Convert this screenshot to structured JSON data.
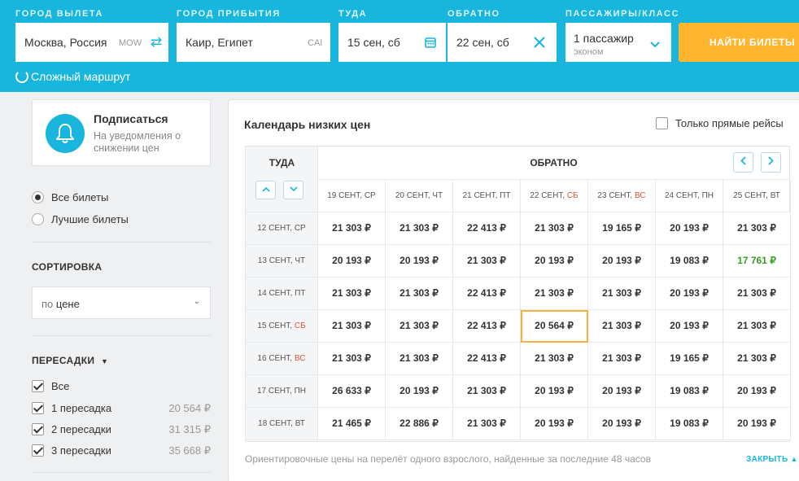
{
  "search": {
    "from_label": "ГОРОД ВЫЛЕТА",
    "from_value": "Москва, Россия",
    "from_code": "MOW",
    "to_label": "ГОРОД ПРИБЫТИЯ",
    "to_value": "Каир, Египет",
    "to_code": "CAI",
    "depart_label": "ТУДА",
    "depart_value": "15 сен, сб",
    "return_label": "ОБРАТНО",
    "return_value": "22 сен, сб",
    "pax_label": "ПАССАЖИРЫ/КЛАСС",
    "pax_value": "1 пассажир",
    "class_value": "эконом",
    "search_button": "НАЙТИ БИЛЕТЫ",
    "complex_route": "Сложный маршрут",
    "accent_color": "#18b5dc",
    "button_color": "#ffb52e"
  },
  "sidebar": {
    "subscribe_title": "Подписаться",
    "subscribe_text": "На уведомления о снижении цен",
    "radio_all": "Все билеты",
    "radio_best": "Лучшие билеты",
    "sort_title": "СОРТИРОВКА",
    "sort_prefix": "по",
    "sort_value": "цене",
    "transfers_title": "ПЕРЕСАДКИ",
    "transfers": [
      {
        "label": "Все",
        "price": "",
        "checked": true
      },
      {
        "label": "1 пересадка",
        "price": "20 564 ₽",
        "checked": true
      },
      {
        "label": "2 пересадки",
        "price": "31 315 ₽",
        "checked": true
      },
      {
        "label": "3 пересадки",
        "price": "35 668 ₽",
        "checked": true
      }
    ]
  },
  "calendar": {
    "title": "Календарь низких цен",
    "direct_only": "Только прямые рейсы",
    "depart_header": "ТУДА",
    "return_header": "ОБРАТНО",
    "columns": [
      {
        "date": "19 СЕНТ,",
        "day": "СР",
        "weekend": false
      },
      {
        "date": "20 СЕНТ,",
        "day": "ЧТ",
        "weekend": false
      },
      {
        "date": "21 СЕНТ,",
        "day": "ПТ",
        "weekend": false
      },
      {
        "date": "22 СЕНТ,",
        "day": "СБ",
        "weekend": true
      },
      {
        "date": "23 СЕНТ,",
        "day": "ВС",
        "weekend": true
      },
      {
        "date": "24 СЕНТ,",
        "day": "ПН",
        "weekend": false
      },
      {
        "date": "25 СЕНТ,",
        "day": "ВТ",
        "weekend": false
      }
    ],
    "rows": [
      {
        "date": "12 СЕНТ,",
        "day": "СР",
        "weekend": false,
        "prices": [
          "21 303 ₽",
          "21 303 ₽",
          "22 413 ₽",
          "21 303 ₽",
          "19 165 ₽",
          "20 193 ₽",
          "21 303 ₽"
        ]
      },
      {
        "date": "13 СЕНТ,",
        "day": "ЧТ",
        "weekend": false,
        "prices": [
          "20 193 ₽",
          "20 193 ₽",
          "21 303 ₽",
          "20 193 ₽",
          "20 193 ₽",
          "19 083 ₽",
          "17 761 ₽"
        ]
      },
      {
        "date": "14 СЕНТ,",
        "day": "ПТ",
        "weekend": false,
        "prices": [
          "21 303 ₽",
          "21 303 ₽",
          "22 413 ₽",
          "21 303 ₽",
          "21 303 ₽",
          "20 193 ₽",
          "21 303 ₽"
        ]
      },
      {
        "date": "15 СЕНТ,",
        "day": "СБ",
        "weekend": true,
        "prices": [
          "21 303 ₽",
          "21 303 ₽",
          "22 413 ₽",
          "20 564 ₽",
          "21 303 ₽",
          "20 193 ₽",
          "21 303 ₽"
        ]
      },
      {
        "date": "16 СЕНТ,",
        "day": "ВС",
        "weekend": true,
        "prices": [
          "21 303 ₽",
          "21 303 ₽",
          "22 413 ₽",
          "21 303 ₽",
          "21 303 ₽",
          "19 165 ₽",
          "21 303 ₽"
        ]
      },
      {
        "date": "17 СЕНТ,",
        "day": "ПН",
        "weekend": false,
        "prices": [
          "26 633 ₽",
          "20 193 ₽",
          "21 303 ₽",
          "20 193 ₽",
          "20 193 ₽",
          "19 083 ₽",
          "20 193 ₽"
        ]
      },
      {
        "date": "18 СЕНТ,",
        "day": "ВТ",
        "weekend": false,
        "prices": [
          "21 465 ₽",
          "22 886 ₽",
          "21 303 ₽",
          "20 193 ₽",
          "20 193 ₽",
          "19 083 ₽",
          "20 193 ₽"
        ]
      }
    ],
    "selected": {
      "row": 3,
      "col": 3
    },
    "cheapest": {
      "row": 1,
      "col": 6
    },
    "footnote": "Ориентировочные цены на перелёт одного взрослого, найденные за последние 48 часов",
    "close_link": "ЗАКРЫТЬ"
  }
}
